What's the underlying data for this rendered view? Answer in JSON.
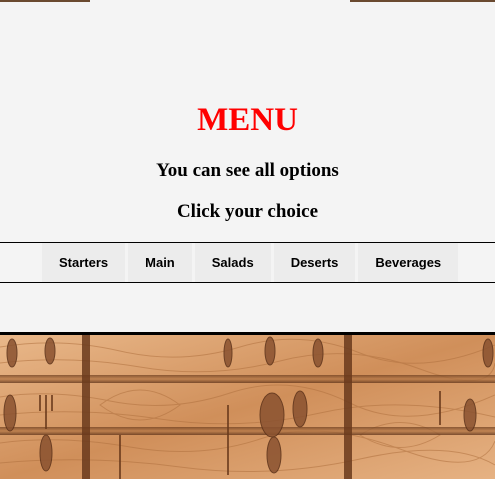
{
  "header": {
    "title": "MENU",
    "subtitle": "You can see all options",
    "instruction": "Click your choice"
  },
  "nav": {
    "items": [
      {
        "label": "Starters"
      },
      {
        "label": "Main"
      },
      {
        "label": "Salads"
      },
      {
        "label": "Deserts"
      },
      {
        "label": "Beverages"
      }
    ]
  },
  "colors": {
    "title": "#ff0000",
    "page_background": "#f4f4f4",
    "nav_item_background": "#ececec",
    "wood_light": "#e9b88a",
    "wood_dark": "#8a5230"
  },
  "decor": {
    "background_image": "wooden-cutlery-drawer"
  }
}
